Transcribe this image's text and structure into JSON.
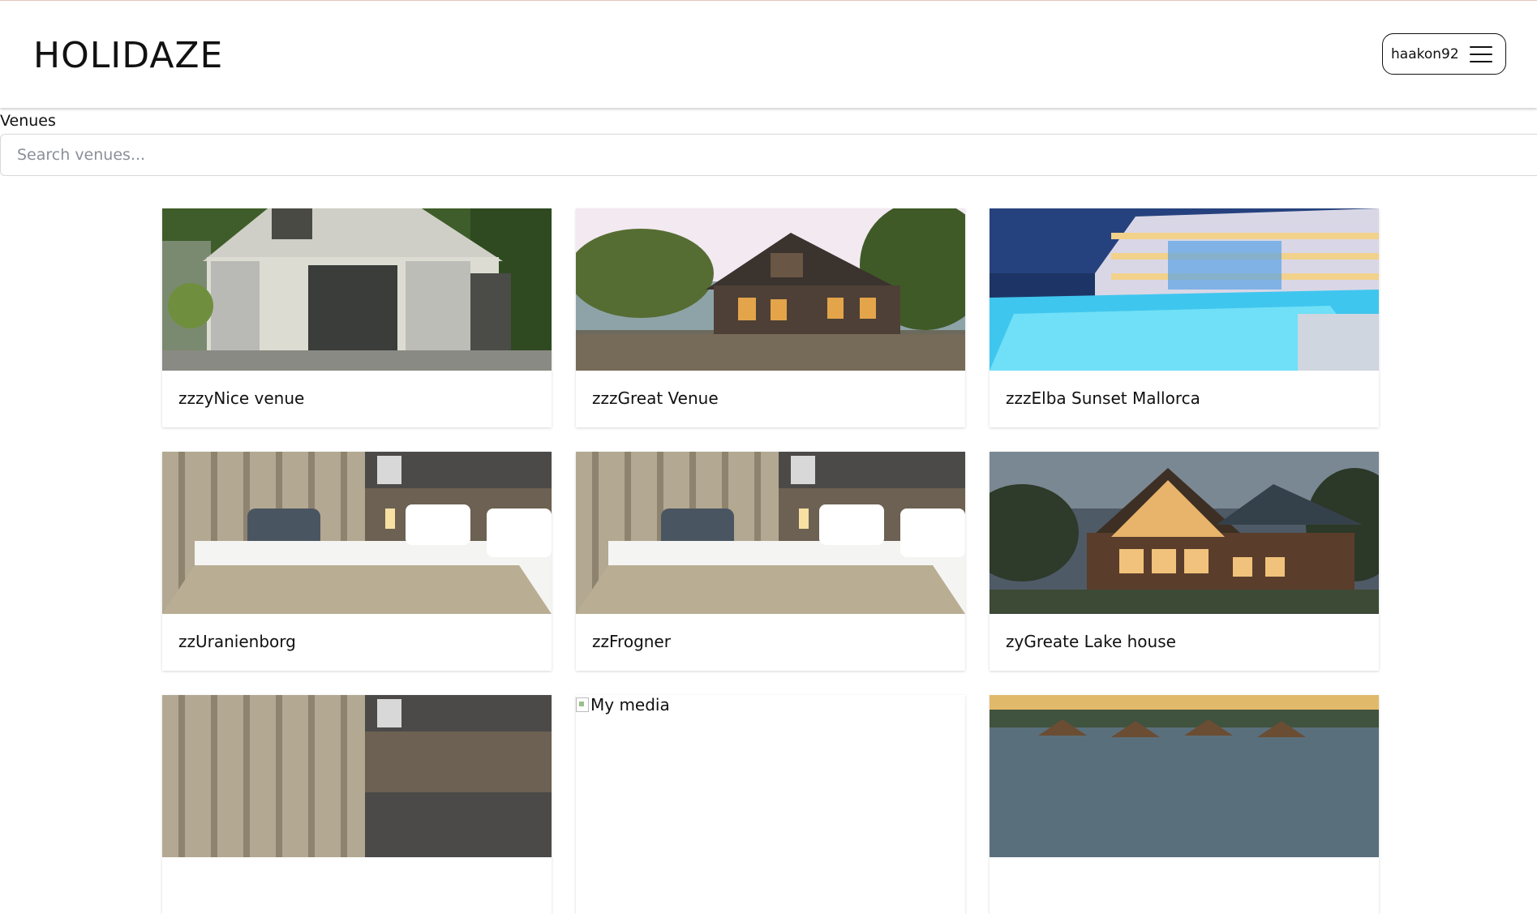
{
  "app": {
    "title": "HOLIDAZE"
  },
  "header": {
    "username": "haakon92"
  },
  "search": {
    "label": "Venues",
    "placeholder": "Search venues..."
  },
  "venues": [
    {
      "name": "zzzyNice venue",
      "image": "shed-photo"
    },
    {
      "name": "zzzGreat Venue",
      "image": "lake-cabin-photo"
    },
    {
      "name": "zzzElba Sunset Mallorca",
      "image": "resort-pool-photo"
    },
    {
      "name": "zzUranienborg",
      "image": "hotel-bedroom-photo"
    },
    {
      "name": "zzFrogner",
      "image": "hotel-bedroom-photo"
    },
    {
      "name": "zyGreate Lake house",
      "image": "log-house-photo"
    },
    {
      "name": "",
      "image": "hotel-bedroom-photo"
    },
    {
      "name": "",
      "image": "broken-image",
      "image_alt": "My media"
    },
    {
      "name": "",
      "image": "tropical-resort-photo"
    }
  ]
}
